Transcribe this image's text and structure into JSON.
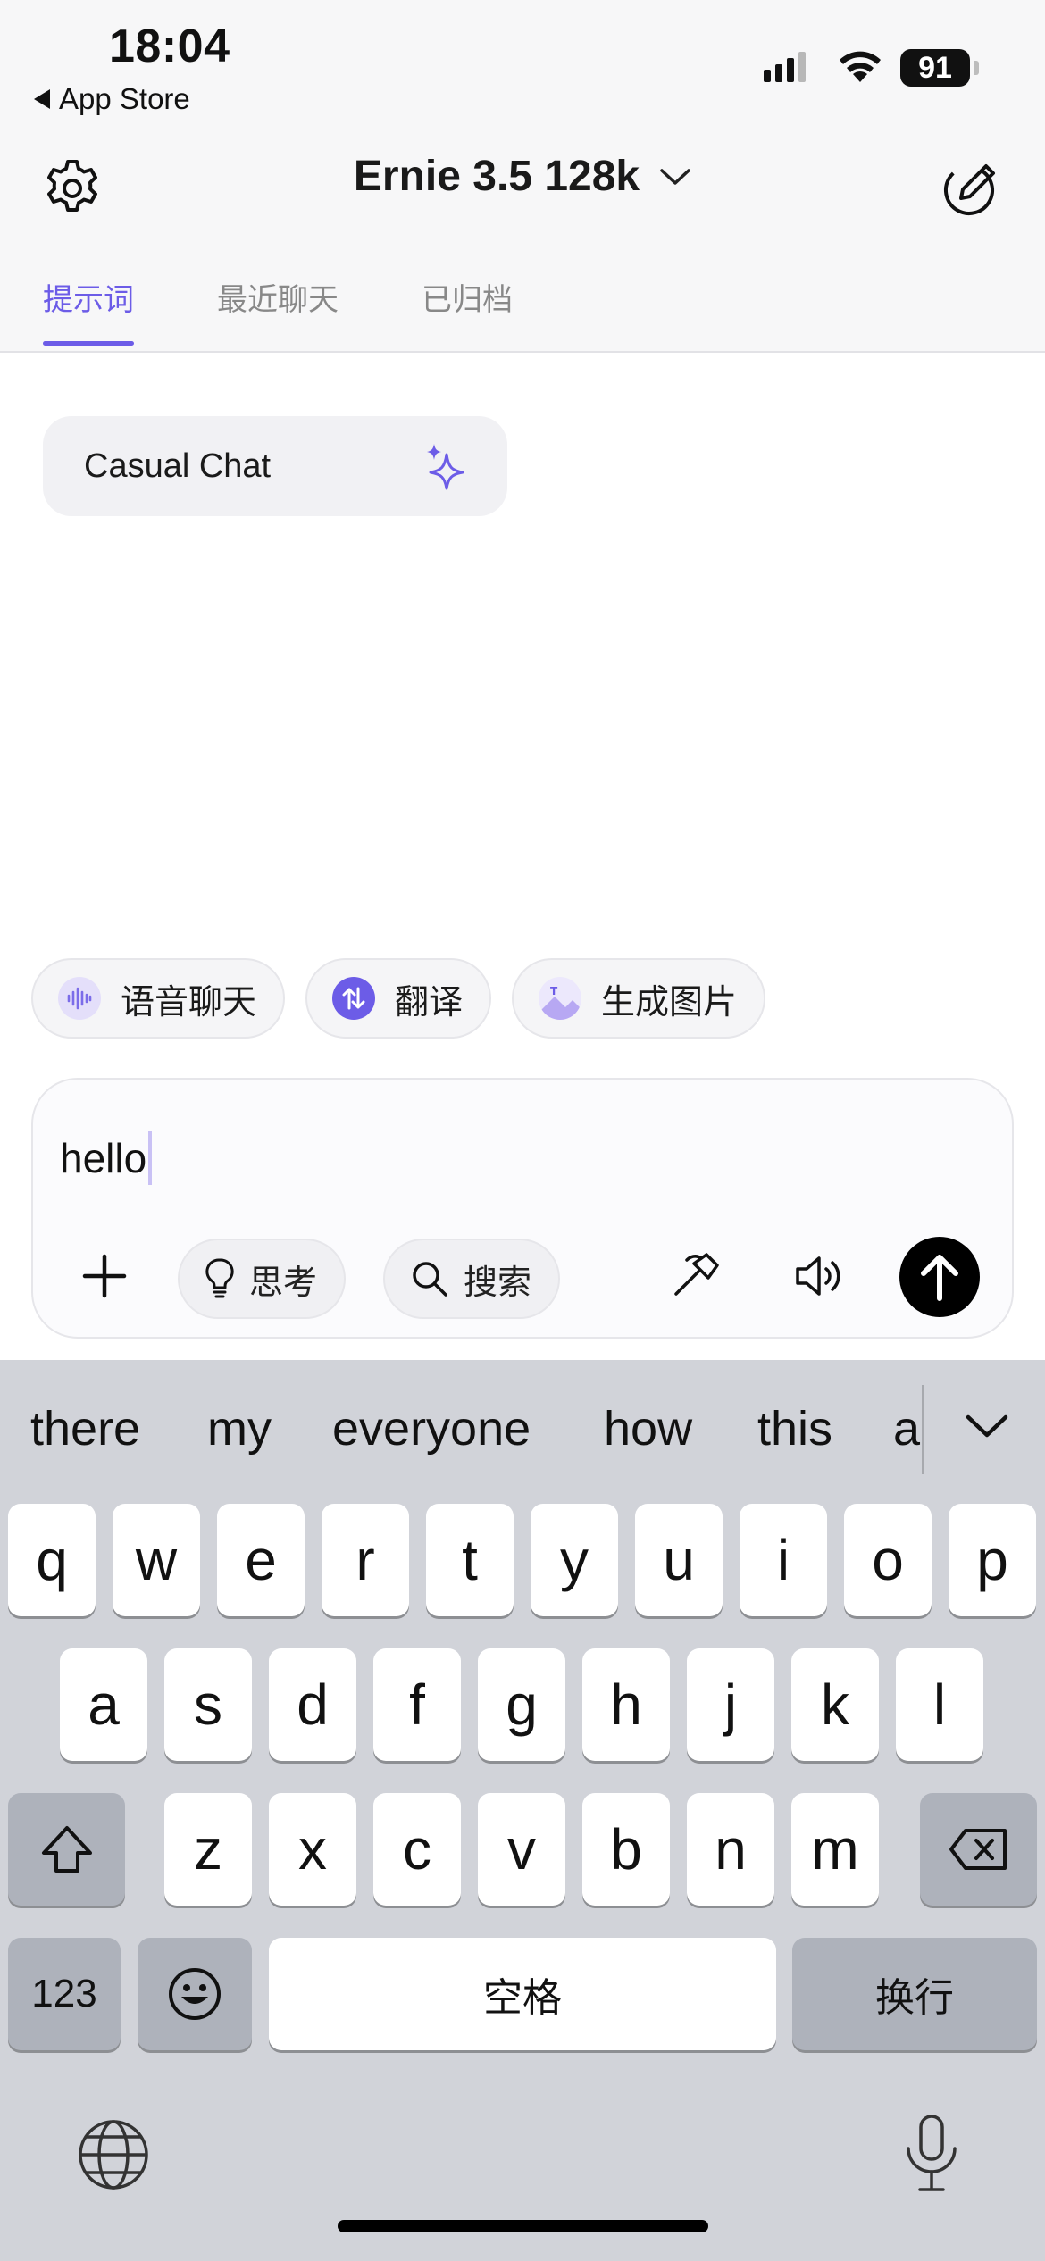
{
  "status_bar": {
    "time": "18:04",
    "back_app": "App Store",
    "battery": "91"
  },
  "header": {
    "model_name": "Ernie 3.5 128k",
    "tabs": [
      {
        "label": "提示词",
        "active": true
      },
      {
        "label": "最近聊天",
        "active": false
      },
      {
        "label": "已归档",
        "active": false
      }
    ]
  },
  "prompt_card": {
    "label": "Casual Chat"
  },
  "quick_actions": [
    {
      "label": "语音聊天",
      "icon": "voice-wave-icon"
    },
    {
      "label": "翻译",
      "icon": "translate-icon"
    },
    {
      "label": "生成图片",
      "icon": "image-generate-icon"
    }
  ],
  "composer": {
    "text": "hello",
    "tools": {
      "think_label": "思考",
      "search_label": "搜索"
    }
  },
  "keyboard": {
    "suggestions": [
      "there",
      "my",
      "everyone",
      "how",
      "this",
      "a"
    ],
    "row1": [
      "q",
      "w",
      "e",
      "r",
      "t",
      "y",
      "u",
      "i",
      "o",
      "p"
    ],
    "row2": [
      "a",
      "s",
      "d",
      "f",
      "g",
      "h",
      "j",
      "k",
      "l"
    ],
    "row3": [
      "z",
      "x",
      "c",
      "v",
      "b",
      "n",
      "m"
    ],
    "numbers_label": "123",
    "space_label": "空格",
    "return_label": "换行"
  },
  "colors": {
    "accent": "#6c5ce7",
    "header_bg": "#f7f7f8",
    "keyboard_bg": "#d1d3d9"
  }
}
